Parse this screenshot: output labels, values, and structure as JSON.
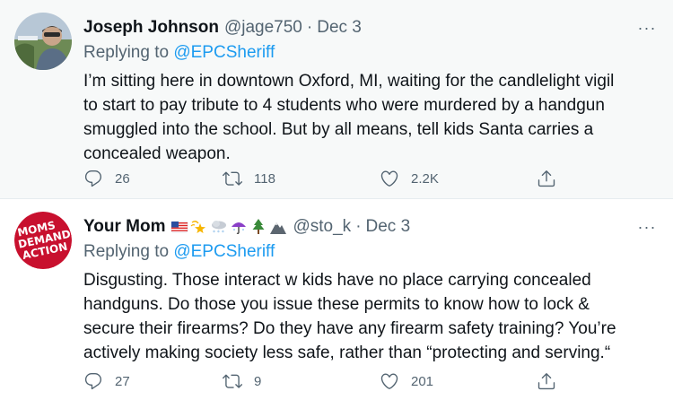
{
  "tweets": [
    {
      "display_name": "Joseph Johnson",
      "handle": "@jage750",
      "separator": "·",
      "date": "Dec 3",
      "replying_prefix": "Replying to ",
      "replying_to": "@EPCSheriff",
      "text": "I’m sitting here in downtown Oxford, MI, waiting for the candlelight vigil to start to pay tribute to 4 students who were murdered by a handgun smuggled into the school. But by all means, tell kids Santa carries a concealed weapon.",
      "replies": "26",
      "retweets": "118",
      "likes": "2.2K",
      "more_label": "···"
    },
    {
      "display_name": "Your Mom",
      "emoji_icons": [
        "us-flag-icon",
        "dizzy-star-icon",
        "snow-cloud-icon",
        "umbrella-icon",
        "evergreen-tree-icon",
        "mountain-icon"
      ],
      "handle": "@sto_k",
      "separator": "·",
      "date": "Dec 3",
      "replying_prefix": "Replying to ",
      "replying_to": "@EPCSheriff",
      "text": "Disgusting. Those interact w kids have no place carrying concealed handguns. Do those you issue these permits to know how to lock & secure their firearms? Do they have any firearm safety training? You’re actively making society less safe, rather than “protecting and serving.“",
      "replies": "27",
      "retweets": "9",
      "likes": "201",
      "more_label": "···",
      "avatar_text": [
        "MOMS",
        "DEMAND",
        "ACTION"
      ]
    }
  ],
  "colors": {
    "link": "#1d9bf0",
    "secondary_text": "#536471",
    "primary_text": "#0f1419",
    "thread_line": "#cfd9de",
    "moms_demand_red": "#c8102e"
  }
}
